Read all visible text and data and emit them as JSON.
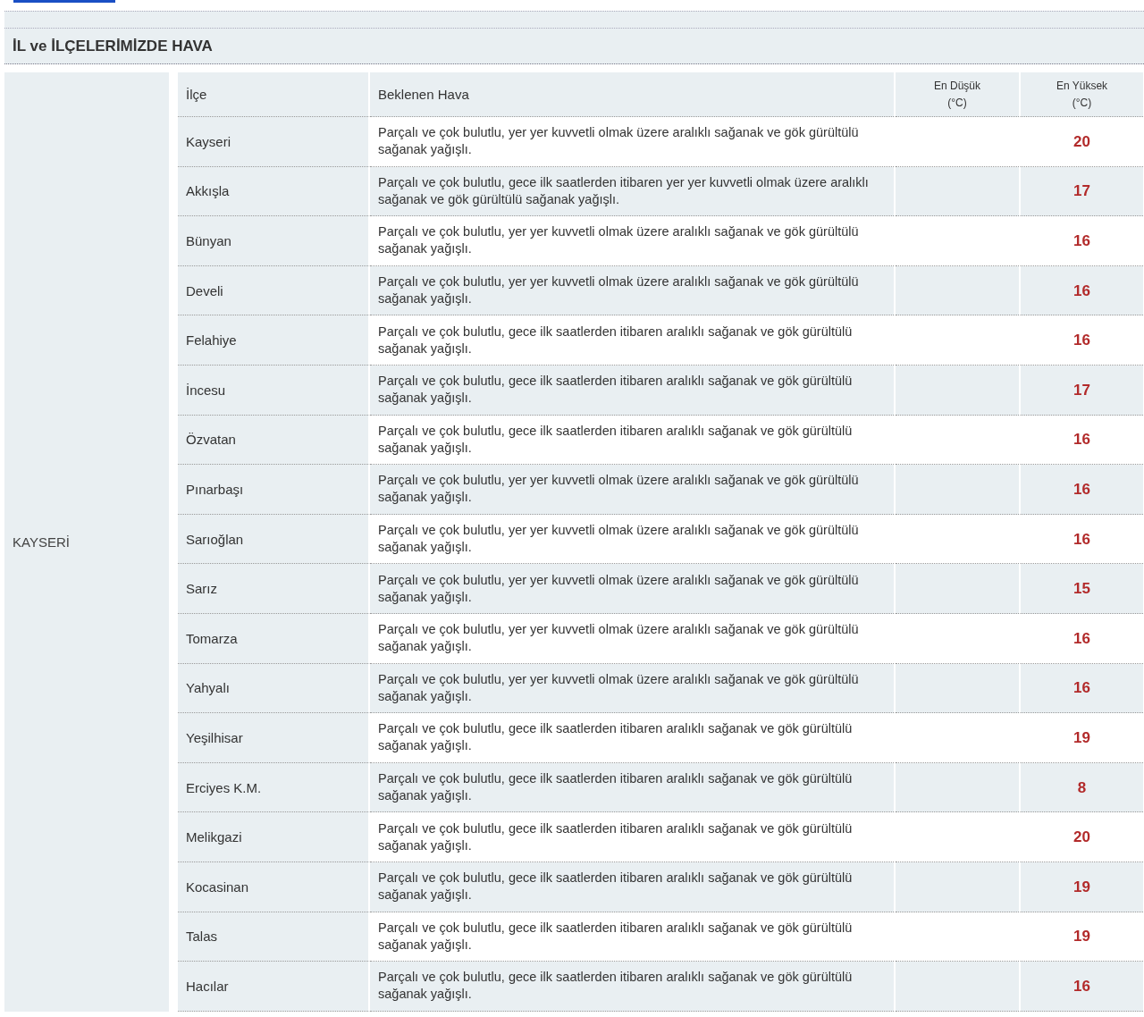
{
  "section": {
    "title": "İL ve İLÇELERİMİZDE HAVA",
    "province": "KAYSERİ"
  },
  "table": {
    "columns": [
      "İlçe",
      "Beklenen Hava",
      [
        "En Düşük",
        "(°C)"
      ],
      [
        "En Yüksek",
        "(°C)"
      ]
    ],
    "rows": [
      {
        "district": "Kayseri",
        "forecast": "Parçalı ve çok bulutlu, yer yer kuvvetli olmak üzere aralıklı sağanak ve gök gürültülü sağanak yağışlı.",
        "high": "20"
      },
      {
        "district": "Akkışla",
        "forecast": "Parçalı ve çok bulutlu, gece ilk saatlerden itibaren yer yer kuvvetli olmak üzere aralıklı sağanak ve gök gürültülü sağanak yağışlı.",
        "high": "17"
      },
      {
        "district": "Bünyan",
        "forecast": "Parçalı ve çok bulutlu, yer yer kuvvetli olmak üzere aralıklı sağanak ve gök gürültülü sağanak yağışlı.",
        "high": "16"
      },
      {
        "district": "Develi",
        "forecast": "Parçalı ve çok bulutlu, yer yer kuvvetli olmak üzere aralıklı sağanak ve gök gürültülü sağanak yağışlı.",
        "high": "16"
      },
      {
        "district": "Felahiye",
        "forecast": "Parçalı ve çok bulutlu, gece ilk saatlerden itibaren aralıklı sağanak ve gök gürültülü sağanak yağışlı.",
        "high": "16"
      },
      {
        "district": "İncesu",
        "forecast": "Parçalı ve çok bulutlu, gece ilk saatlerden itibaren aralıklı sağanak ve gök gürültülü sağanak yağışlı.",
        "high": "17"
      },
      {
        "district": "Özvatan",
        "forecast": "Parçalı ve çok bulutlu, gece ilk saatlerden itibaren aralıklı sağanak ve gök gürültülü sağanak yağışlı.",
        "high": "16"
      },
      {
        "district": "Pınarbaşı",
        "forecast": "Parçalı ve çok bulutlu, yer yer kuvvetli olmak üzere aralıklı sağanak ve gök gürültülü sağanak yağışlı.",
        "high": "16"
      },
      {
        "district": "Sarıoğlan",
        "forecast": "Parçalı ve çok bulutlu, yer yer kuvvetli olmak üzere aralıklı sağanak ve gök gürültülü sağanak yağışlı.",
        "high": "16"
      },
      {
        "district": "Sarız",
        "forecast": "Parçalı ve çok bulutlu, yer yer kuvvetli olmak üzere aralıklı sağanak ve gök gürültülü sağanak yağışlı.",
        "high": "15"
      },
      {
        "district": "Tomarza",
        "forecast": "Parçalı ve çok bulutlu, yer yer kuvvetli olmak üzere aralıklı sağanak ve gök gürültülü sağanak yağışlı.",
        "high": "16"
      },
      {
        "district": "Yahyalı",
        "forecast": "Parçalı ve çok bulutlu, yer yer kuvvetli olmak üzere aralıklı sağanak ve gök gürültülü sağanak yağışlı.",
        "high": "16"
      },
      {
        "district": "Yeşilhisar",
        "forecast": "Parçalı ve çok bulutlu, gece ilk saatlerden itibaren aralıklı sağanak ve gök gürültülü sağanak yağışlı.",
        "high": "19"
      },
      {
        "district": "Erciyes K.M.",
        "forecast": "Parçalı ve çok bulutlu, gece ilk saatlerden itibaren aralıklı sağanak ve gök gürültülü sağanak yağışlı.",
        "high": "8"
      },
      {
        "district": "Melikgazi",
        "forecast": "Parçalı ve çok bulutlu, gece ilk saatlerden itibaren aralıklı sağanak ve gök gürültülü sağanak yağışlı.",
        "high": "20"
      },
      {
        "district": "Kocasinan",
        "forecast": "Parçalı ve çok bulutlu, gece ilk saatlerden itibaren aralıklı sağanak ve gök gürültülü sağanak yağışlı.",
        "high": "19"
      },
      {
        "district": "Talas",
        "forecast": "Parçalı ve çok bulutlu, gece ilk saatlerden itibaren aralıklı sağanak ve gök gürültülü sağanak yağışlı.",
        "high": "19"
      },
      {
        "district": "Hacılar",
        "forecast": "Parçalı ve çok bulutlu, gece ilk saatlerden itibaren aralıklı sağanak ve gök gürültülü sağanak yağışlı.",
        "high": "16"
      }
    ]
  }
}
